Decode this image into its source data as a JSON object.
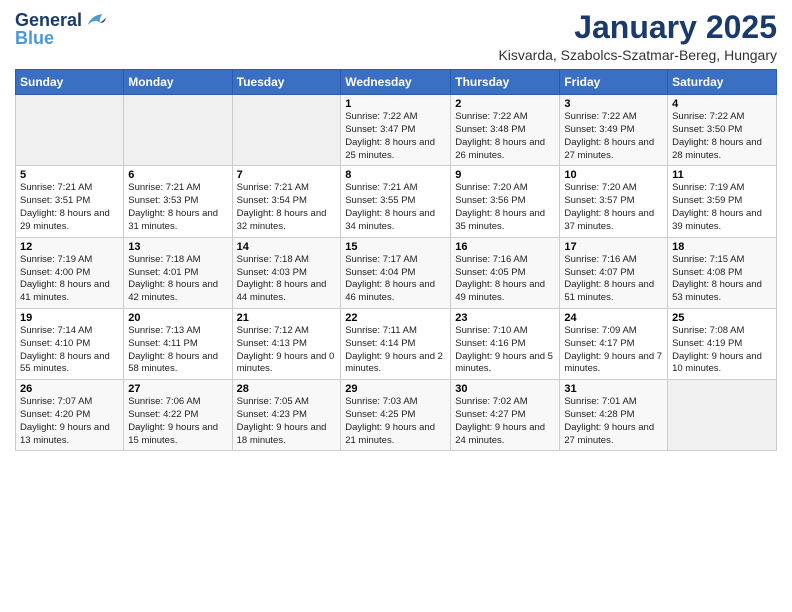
{
  "logo": {
    "line1": "General",
    "line2": "Blue"
  },
  "title": "January 2025",
  "subtitle": "Kisvarda, Szabolcs-Szatmar-Bereg, Hungary",
  "days_of_week": [
    "Sunday",
    "Monday",
    "Tuesday",
    "Wednesday",
    "Thursday",
    "Friday",
    "Saturday"
  ],
  "weeks": [
    [
      {
        "day": "",
        "info": ""
      },
      {
        "day": "",
        "info": ""
      },
      {
        "day": "",
        "info": ""
      },
      {
        "day": "1",
        "info": "Sunrise: 7:22 AM\nSunset: 3:47 PM\nDaylight: 8 hours and 25 minutes."
      },
      {
        "day": "2",
        "info": "Sunrise: 7:22 AM\nSunset: 3:48 PM\nDaylight: 8 hours and 26 minutes."
      },
      {
        "day": "3",
        "info": "Sunrise: 7:22 AM\nSunset: 3:49 PM\nDaylight: 8 hours and 27 minutes."
      },
      {
        "day": "4",
        "info": "Sunrise: 7:22 AM\nSunset: 3:50 PM\nDaylight: 8 hours and 28 minutes."
      }
    ],
    [
      {
        "day": "5",
        "info": "Sunrise: 7:21 AM\nSunset: 3:51 PM\nDaylight: 8 hours and 29 minutes."
      },
      {
        "day": "6",
        "info": "Sunrise: 7:21 AM\nSunset: 3:53 PM\nDaylight: 8 hours and 31 minutes."
      },
      {
        "day": "7",
        "info": "Sunrise: 7:21 AM\nSunset: 3:54 PM\nDaylight: 8 hours and 32 minutes."
      },
      {
        "day": "8",
        "info": "Sunrise: 7:21 AM\nSunset: 3:55 PM\nDaylight: 8 hours and 34 minutes."
      },
      {
        "day": "9",
        "info": "Sunrise: 7:20 AM\nSunset: 3:56 PM\nDaylight: 8 hours and 35 minutes."
      },
      {
        "day": "10",
        "info": "Sunrise: 7:20 AM\nSunset: 3:57 PM\nDaylight: 8 hours and 37 minutes."
      },
      {
        "day": "11",
        "info": "Sunrise: 7:19 AM\nSunset: 3:59 PM\nDaylight: 8 hours and 39 minutes."
      }
    ],
    [
      {
        "day": "12",
        "info": "Sunrise: 7:19 AM\nSunset: 4:00 PM\nDaylight: 8 hours and 41 minutes."
      },
      {
        "day": "13",
        "info": "Sunrise: 7:18 AM\nSunset: 4:01 PM\nDaylight: 8 hours and 42 minutes."
      },
      {
        "day": "14",
        "info": "Sunrise: 7:18 AM\nSunset: 4:03 PM\nDaylight: 8 hours and 44 minutes."
      },
      {
        "day": "15",
        "info": "Sunrise: 7:17 AM\nSunset: 4:04 PM\nDaylight: 8 hours and 46 minutes."
      },
      {
        "day": "16",
        "info": "Sunrise: 7:16 AM\nSunset: 4:05 PM\nDaylight: 8 hours and 49 minutes."
      },
      {
        "day": "17",
        "info": "Sunrise: 7:16 AM\nSunset: 4:07 PM\nDaylight: 8 hours and 51 minutes."
      },
      {
        "day": "18",
        "info": "Sunrise: 7:15 AM\nSunset: 4:08 PM\nDaylight: 8 hours and 53 minutes."
      }
    ],
    [
      {
        "day": "19",
        "info": "Sunrise: 7:14 AM\nSunset: 4:10 PM\nDaylight: 8 hours and 55 minutes."
      },
      {
        "day": "20",
        "info": "Sunrise: 7:13 AM\nSunset: 4:11 PM\nDaylight: 8 hours and 58 minutes."
      },
      {
        "day": "21",
        "info": "Sunrise: 7:12 AM\nSunset: 4:13 PM\nDaylight: 9 hours and 0 minutes."
      },
      {
        "day": "22",
        "info": "Sunrise: 7:11 AM\nSunset: 4:14 PM\nDaylight: 9 hours and 2 minutes."
      },
      {
        "day": "23",
        "info": "Sunrise: 7:10 AM\nSunset: 4:16 PM\nDaylight: 9 hours and 5 minutes."
      },
      {
        "day": "24",
        "info": "Sunrise: 7:09 AM\nSunset: 4:17 PM\nDaylight: 9 hours and 7 minutes."
      },
      {
        "day": "25",
        "info": "Sunrise: 7:08 AM\nSunset: 4:19 PM\nDaylight: 9 hours and 10 minutes."
      }
    ],
    [
      {
        "day": "26",
        "info": "Sunrise: 7:07 AM\nSunset: 4:20 PM\nDaylight: 9 hours and 13 minutes."
      },
      {
        "day": "27",
        "info": "Sunrise: 7:06 AM\nSunset: 4:22 PM\nDaylight: 9 hours and 15 minutes."
      },
      {
        "day": "28",
        "info": "Sunrise: 7:05 AM\nSunset: 4:23 PM\nDaylight: 9 hours and 18 minutes."
      },
      {
        "day": "29",
        "info": "Sunrise: 7:03 AM\nSunset: 4:25 PM\nDaylight: 9 hours and 21 minutes."
      },
      {
        "day": "30",
        "info": "Sunrise: 7:02 AM\nSunset: 4:27 PM\nDaylight: 9 hours and 24 minutes."
      },
      {
        "day": "31",
        "info": "Sunrise: 7:01 AM\nSunset: 4:28 PM\nDaylight: 9 hours and 27 minutes."
      },
      {
        "day": "",
        "info": ""
      }
    ]
  ]
}
